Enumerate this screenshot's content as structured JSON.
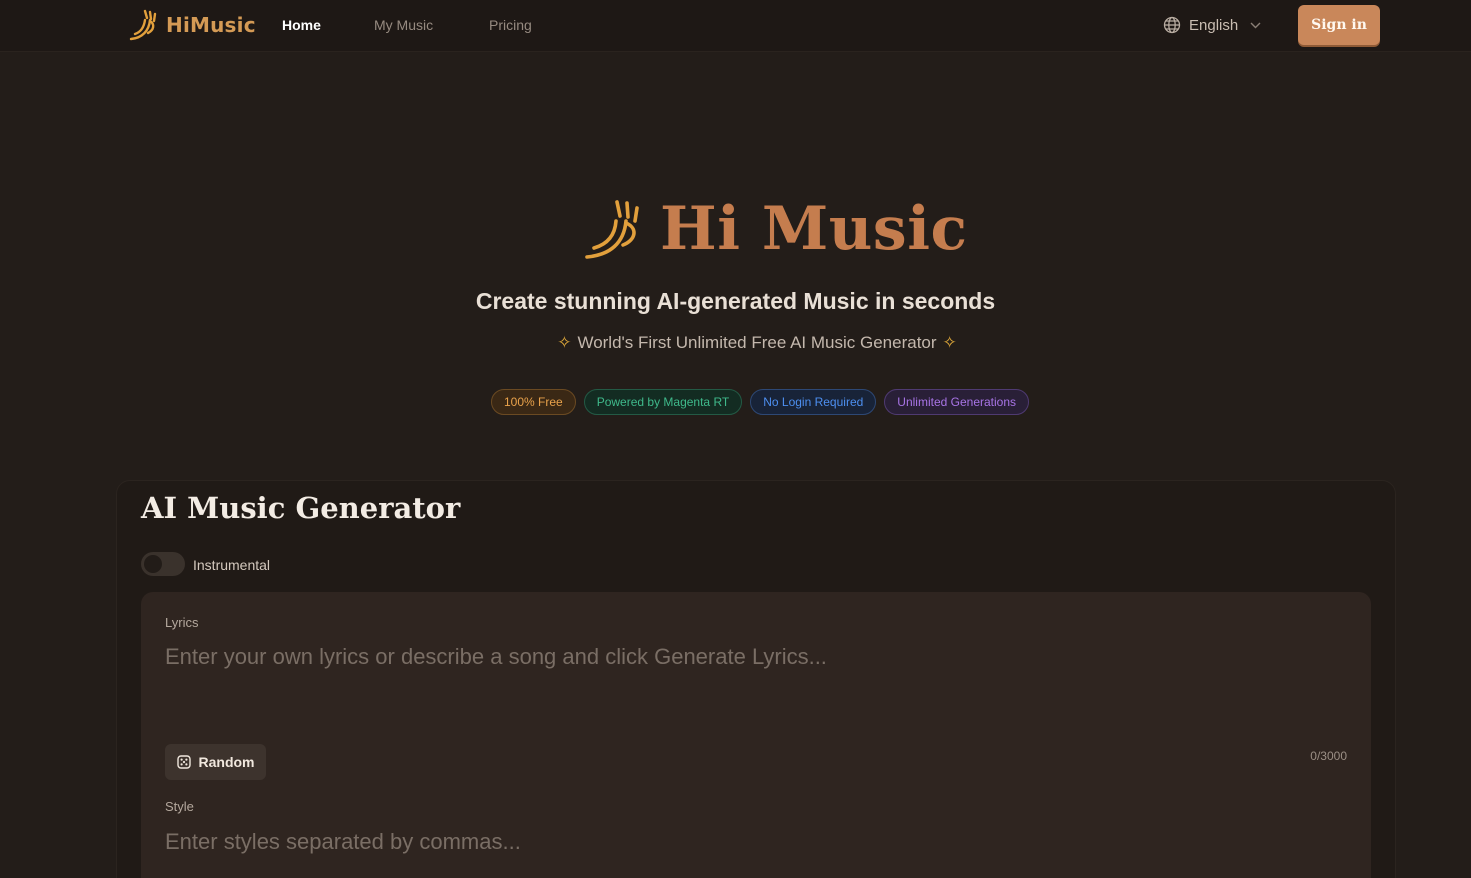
{
  "nav": {
    "brand": "HiMusic",
    "links": [
      "Home",
      "My Music",
      "Pricing"
    ],
    "active": "Home",
    "language": "English",
    "sign_in": "Sign in"
  },
  "hero": {
    "title": "Hi Music",
    "subtitle": "Create stunning AI-generated Music in seconds",
    "tagline": "World's First Unlimited Free AI Music Generator",
    "badges": [
      "100% Free",
      "Powered by Magenta RT",
      "No Login Required",
      "Unlimited Generations"
    ]
  },
  "generator": {
    "title": "AI Music Generator",
    "instrumental_label": "Instrumental",
    "instrumental_on": false,
    "lyrics_label": "Lyrics",
    "lyrics_placeholder": "Enter your own lyrics or describe a song and click Generate Lyrics...",
    "lyrics_value": "",
    "random_label": "Random",
    "counter": "0/3000",
    "style_label": "Style",
    "style_placeholder": "Enter styles separated by commas..."
  },
  "colors": {
    "background": "#231d19",
    "accent": "#c57d4e",
    "brand_gold": "#d49a55",
    "signin_bg": "#c9875a"
  },
  "icons": [
    "himusic-logo-icon",
    "globe-icon",
    "chevron-down-icon",
    "sparkle-icon",
    "dice-icon"
  ]
}
